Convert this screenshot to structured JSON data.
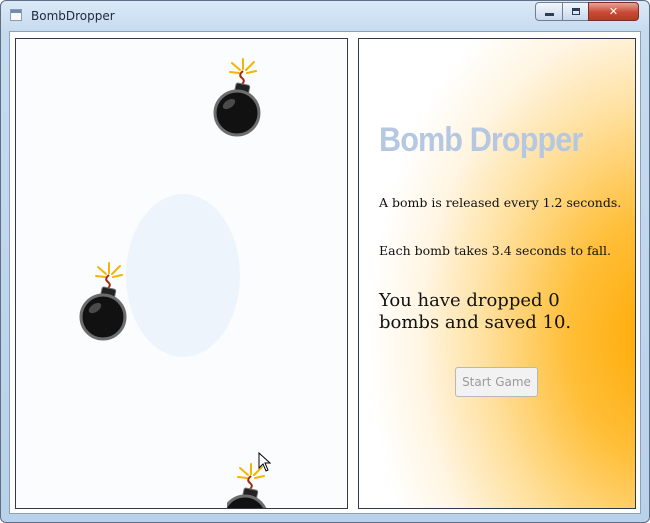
{
  "window": {
    "title": "BombDropper",
    "icons": {
      "app": "app-window-icon",
      "minimize": "minimize-icon",
      "maximize": "maximize-icon",
      "close": "close-icon"
    },
    "close_glyph": "✕"
  },
  "info": {
    "game_title": "Bomb Dropper",
    "release_text": "A bomb is released every 1.2 seconds.",
    "fall_text": "Each bomb takes 3.4 seconds to fall.",
    "status_text": "You have dropped 0 bombs and saved 10.",
    "start_button_label": "Start Game"
  },
  "colors": {
    "title_color": "#b6c7e2",
    "panel_gradient_accent": "#ffa800",
    "fuse_spark": "#f5b400"
  },
  "canvas": {
    "bomb_icon": "bomb-icon",
    "cursor_icon": "mouse-pointer-icon"
  }
}
